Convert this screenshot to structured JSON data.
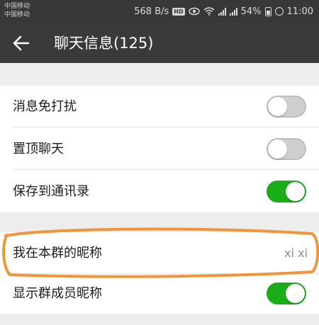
{
  "status_bar": {
    "carrier_1": "中国移动",
    "carrier_2": "中国移动",
    "network_speed": "568 B/s",
    "hd_badge": "HD",
    "battery_level": "54%",
    "time": "11:00",
    "icons": [
      "eye-icon",
      "wifi-icon",
      "signal-2g-icon",
      "signal-4g-icon",
      "battery-icon",
      "alarm-icon"
    ]
  },
  "header": {
    "title": "聊天信息(125)",
    "back_icon": "back-arrow-icon"
  },
  "settings": {
    "group_1": [
      {
        "label": "消息免打扰",
        "toggle": "off"
      },
      {
        "label": "置顶聊天",
        "toggle": "off"
      },
      {
        "label": "保存到通讯录",
        "toggle": "on"
      }
    ],
    "group_2": [
      {
        "label": "我在本群的昵称",
        "value": "xi xi"
      },
      {
        "label": "显示群成员昵称",
        "toggle": "on"
      }
    ]
  },
  "colors": {
    "toggle_on": "#1aad19",
    "toggle_off": "#cfcfcf",
    "header_bg": "#3a3a3a",
    "highlight_stroke": "#f0953a"
  }
}
